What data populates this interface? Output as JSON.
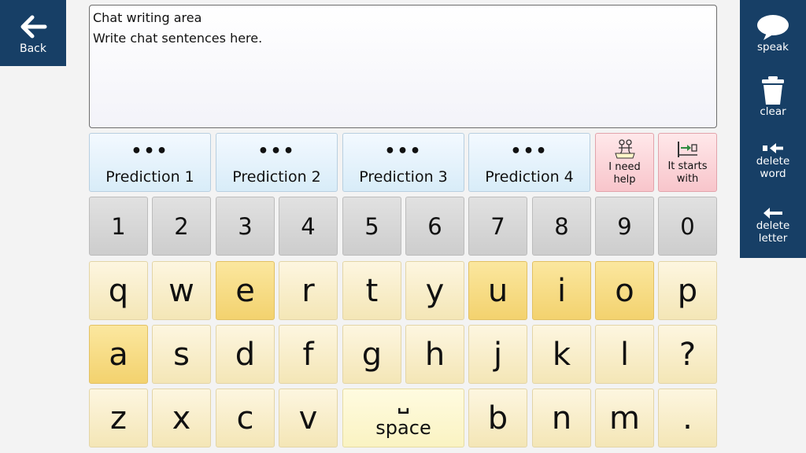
{
  "nav": {
    "back_label": "Back"
  },
  "sidebar": {
    "speak_label": "speak",
    "clear_label": "clear",
    "delete_word_label": [
      "delete",
      "word"
    ],
    "delete_letter_label": [
      "delete",
      "letter"
    ]
  },
  "chat": {
    "title": "Chat writing area",
    "placeholder": "Write chat sentences here."
  },
  "predictions": {
    "dots": "•••",
    "items": [
      "Prediction 1",
      "Prediction 2",
      "Prediction 3",
      "Prediction 4"
    ]
  },
  "helpers": {
    "need_help": [
      "I need",
      "help"
    ],
    "starts_with": [
      "It starts",
      "with"
    ]
  },
  "keys": {
    "numbers": [
      "1",
      "2",
      "3",
      "4",
      "5",
      "6",
      "7",
      "8",
      "9",
      "0"
    ],
    "row1": [
      "q",
      "w",
      "e",
      "r",
      "t",
      "y",
      "u",
      "i",
      "o",
      "p"
    ],
    "row2": [
      "a",
      "s",
      "d",
      "f",
      "g",
      "h",
      "j",
      "k",
      "l",
      "?"
    ],
    "row3_left": [
      "z",
      "x",
      "c",
      "v"
    ],
    "space_symbol": "␣",
    "space_label": "space",
    "row3_right": [
      "b",
      "n",
      "m",
      "."
    ]
  },
  "colors": {
    "nav_bg": "#173f66",
    "vowel_key": "#f3d26e",
    "letter_key": "#f4e6b6",
    "number_key": "#cdcdcd",
    "prediction_key": "#d8ecf8",
    "help_key": "#f8c5cb"
  }
}
